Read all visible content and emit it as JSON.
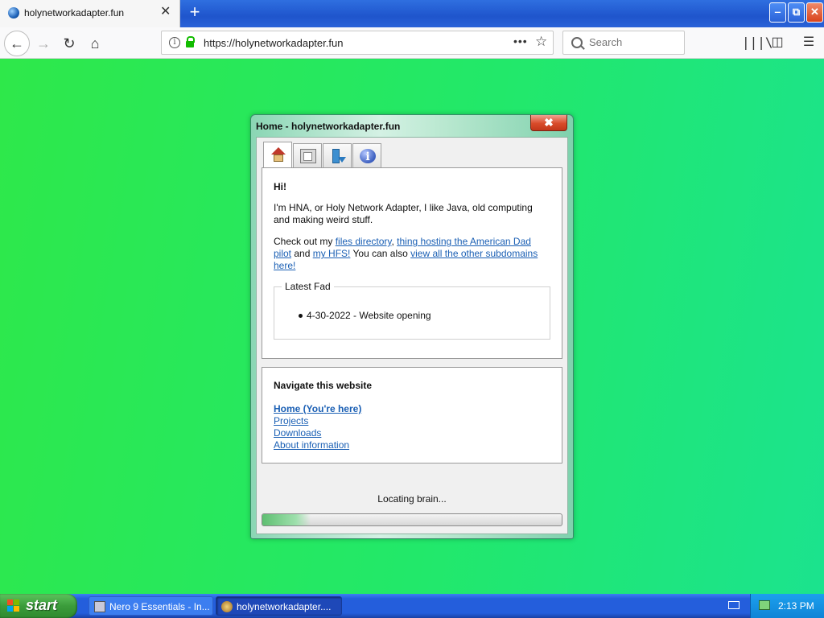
{
  "browser": {
    "tab": {
      "title": "holynetworkadapter.fun"
    },
    "new_tab": "+",
    "url": "https://holynetworkadapter.fun",
    "search_placeholder": "Search",
    "window_buttons": {
      "minimize": "‒",
      "maximize": "⧉",
      "close": "✕"
    }
  },
  "dialog": {
    "title": "Home - holynetworkadapter.fun",
    "close": "✖",
    "tabs": [
      {
        "icon": "house-icon"
      },
      {
        "icon": "window-icon"
      },
      {
        "icon": "download-icon"
      },
      {
        "icon": "info-icon",
        "glyph": "i"
      }
    ],
    "home": {
      "greeting": "Hi!",
      "intro": "I'm HNA, or Holy Network Adapter, I like Java, old computing and making weird stuff.",
      "check_prefix": "Check out my ",
      "link_files": "files directory",
      "comma": ", ",
      "link_american_dad": "thing hosting the American Dad pilot",
      "and": " and ",
      "link_hfs": "my HFS!",
      "also": " You can also ",
      "link_subdomains": "view all the other subdomains here!",
      "latest_fad_legend": "Latest Fad",
      "latest_fad_item": "4-30-2022 - Website opening"
    },
    "navigation": {
      "heading": "Navigate this website",
      "links": [
        "Home (You're here)",
        "Projects",
        "Downloads",
        "About information"
      ]
    },
    "status": "Locating brain...",
    "progress_percent": 16
  },
  "taskbar": {
    "start": "start",
    "tasks": [
      {
        "label": "Nero 9 Essentials - In..."
      },
      {
        "label": "holynetworkadapter...."
      }
    ],
    "clock": "2:13 PM"
  },
  "colors": {
    "page_background": "#2ee85a",
    "link": "#1a5fb4",
    "taskbar": "#245edc"
  }
}
